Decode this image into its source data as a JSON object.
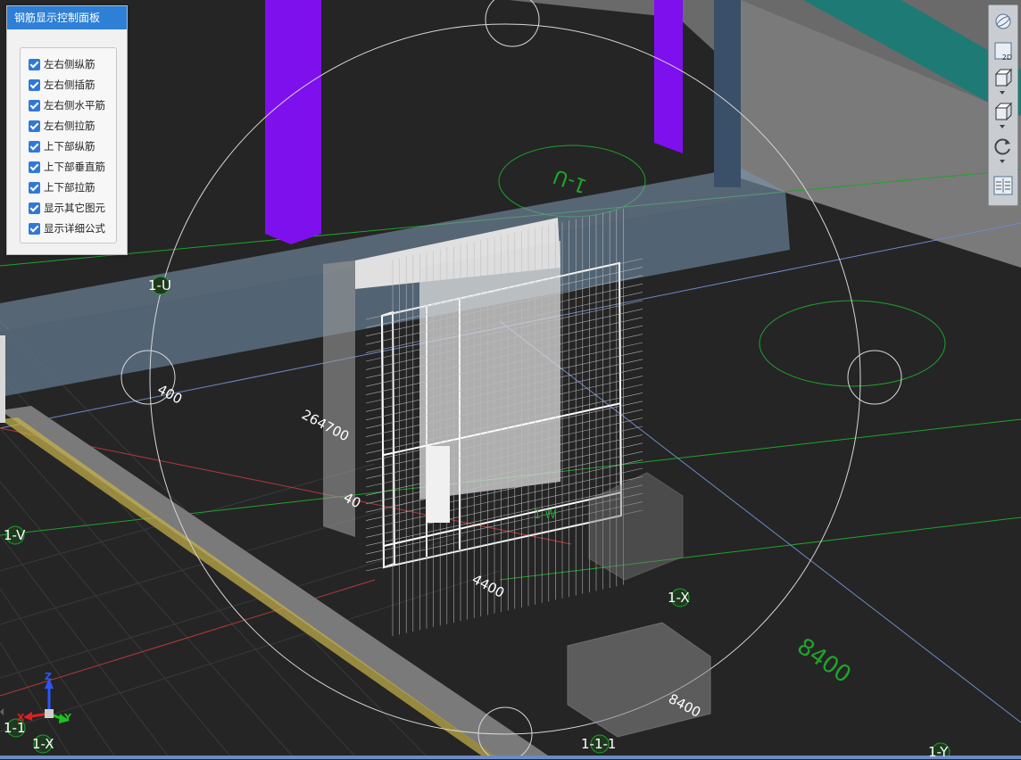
{
  "panel": {
    "title": "钢筋显示控制面板",
    "options": [
      {
        "label": "左右侧纵筋",
        "checked": true
      },
      {
        "label": "左右侧插筋",
        "checked": true
      },
      {
        "label": "左右侧水平筋",
        "checked": true
      },
      {
        "label": "左右侧拉筋",
        "checked": true
      },
      {
        "label": "上下部纵筋",
        "checked": true
      },
      {
        "label": "上下部垂直筋",
        "checked": true
      },
      {
        "label": "上下部拉筋",
        "checked": true
      },
      {
        "label": "显示其它图元",
        "checked": true
      },
      {
        "label": "显示详细公式",
        "checked": true
      }
    ]
  },
  "toolbar": {
    "buttons": [
      {
        "icon": "orbit-sphere-icon"
      },
      {
        "icon": "view-2d-icon",
        "label": "2D"
      },
      {
        "icon": "view-3d-box-icon"
      },
      {
        "icon": "view-cube-icon"
      },
      {
        "icon": "rotate-icon"
      },
      {
        "icon": "layout-grid-icon"
      }
    ]
  },
  "scene": {
    "axis_labels": [
      "1-U",
      "1-V",
      "1-X",
      "1-1",
      "1-X",
      "1-1-1",
      "1-Y"
    ],
    "dimensions": [
      "264700",
      "400",
      "40",
      "4400",
      "8400",
      "8400",
      "1-W",
      "1-U"
    ],
    "triad": {
      "z": "Z",
      "x": "X",
      "y": "Y"
    },
    "colors": {
      "background": "#252525",
      "column": "#7f10ee",
      "grid_green": "#1fa32a",
      "grid_blue": "#6c8bc7",
      "beam": "#6f8aa2"
    }
  }
}
